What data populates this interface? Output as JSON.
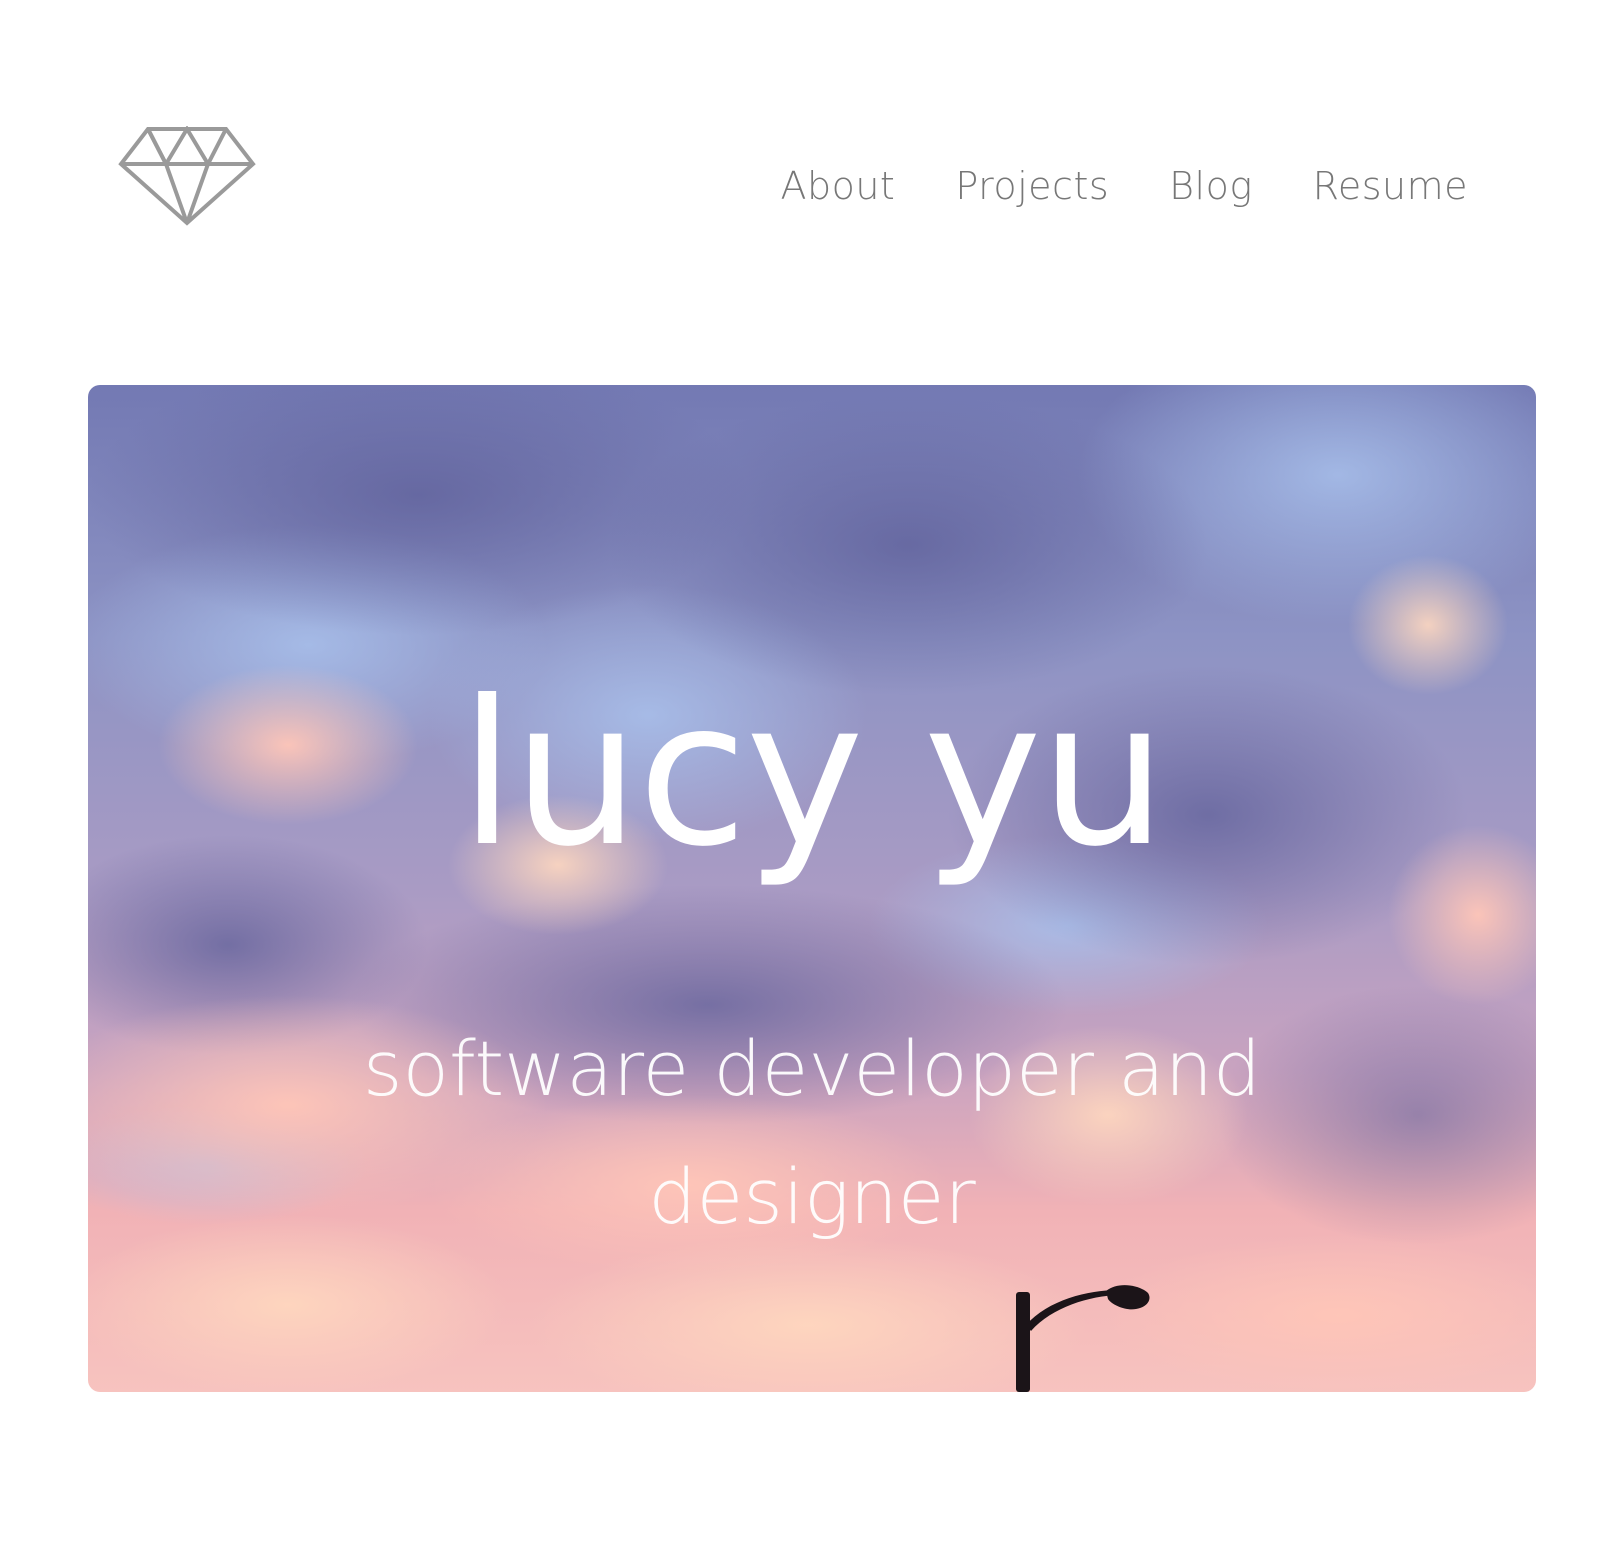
{
  "header": {
    "logo_icon": "diamond-icon",
    "nav": [
      {
        "label": "About"
      },
      {
        "label": "Projects"
      },
      {
        "label": "Blog"
      },
      {
        "label": "Resume"
      }
    ]
  },
  "hero": {
    "name": "lucy yu",
    "tagline": "software developer and designer",
    "background": "sunset-sky-photo"
  },
  "colors": {
    "nav_text": "#777777",
    "logo_stroke": "#999999",
    "hero_text": "#ffffff",
    "sky_top": "#7f86b8",
    "sky_bottom": "#f2b4b8"
  }
}
